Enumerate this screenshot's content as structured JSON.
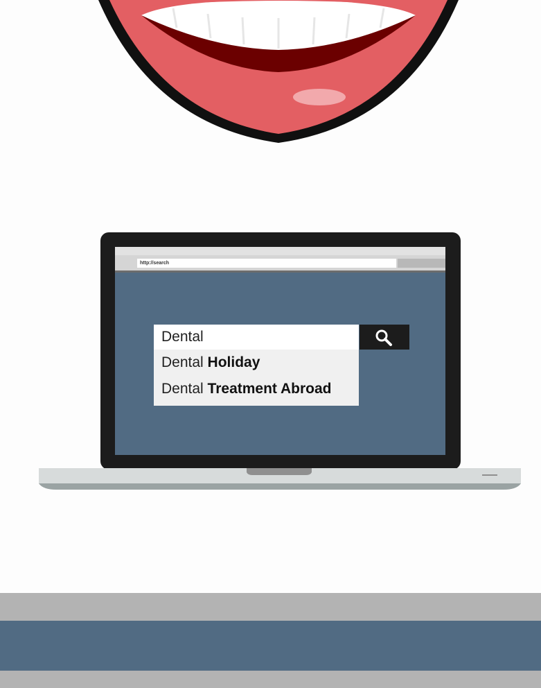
{
  "browser": {
    "url": "http://search"
  },
  "search": {
    "query": "Dental",
    "suggestions": [
      {
        "prefix": "Dental",
        "completion": "Holiday"
      },
      {
        "prefix": "Dental",
        "completion": "Treatment Abroad"
      }
    ]
  },
  "icons": {
    "search_button": "magnifier-icon"
  },
  "colors": {
    "screen": "#516b83",
    "lips": "#e35f63",
    "band": "#516b83"
  }
}
